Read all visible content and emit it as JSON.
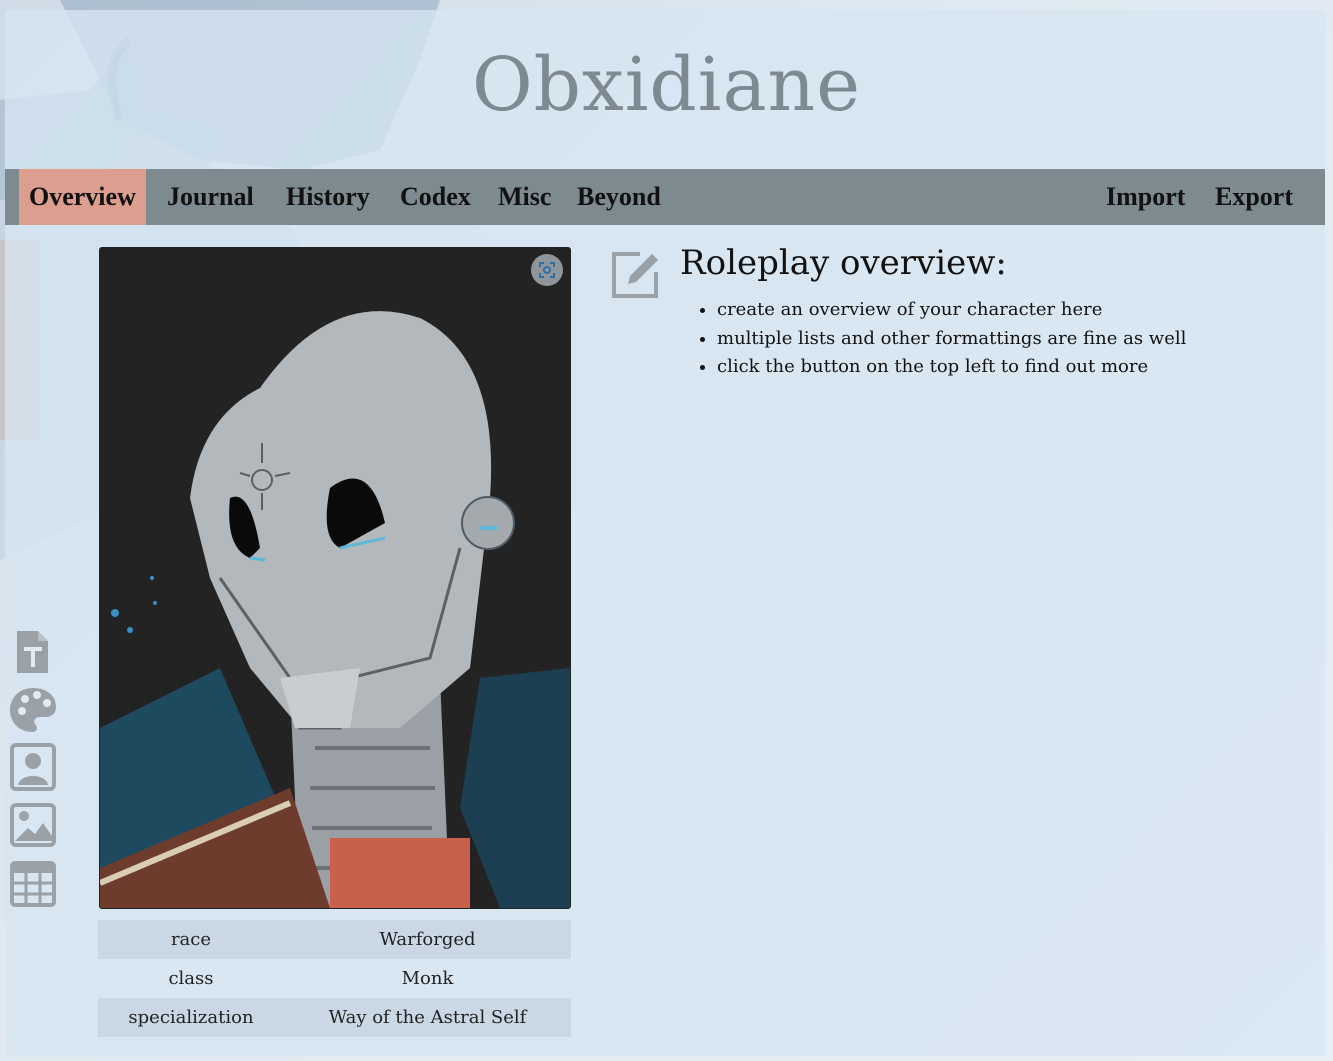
{
  "app": {
    "title": "Obxidiane"
  },
  "nav": {
    "left": [
      {
        "label": "Overview",
        "active": true
      },
      {
        "label": "Journal"
      },
      {
        "label": "History"
      },
      {
        "label": "Codex"
      },
      {
        "label": "Misc"
      },
      {
        "label": "Beyond"
      }
    ],
    "right": [
      {
        "label": "Import"
      },
      {
        "label": "Export"
      }
    ]
  },
  "portrait": {
    "subject": "warforged-monk-portrait",
    "fullscreen_icon": "fullscreen-icon"
  },
  "stats": [
    {
      "key": "race",
      "value": "Warforged"
    },
    {
      "key": "class",
      "value": "Monk"
    },
    {
      "key": "specialization",
      "value": "Way of the Astral Self"
    }
  ],
  "side_toolbar": [
    "text-document-icon",
    "palette-icon",
    "portrait-icon",
    "image-icon",
    "table-icon"
  ],
  "overview": {
    "heading": "Roleplay overview:",
    "items": [
      "create an overview of your character here",
      "multiple lists and other formattings are fine as well",
      "click the button on the top left to find out more"
    ]
  },
  "colors": {
    "nav_bg": "#7d8a90",
    "nav_active": "#dc9e8e",
    "title": "#7d8a92",
    "panel": "#d6e6f2",
    "icon": "#9aa2a8"
  }
}
